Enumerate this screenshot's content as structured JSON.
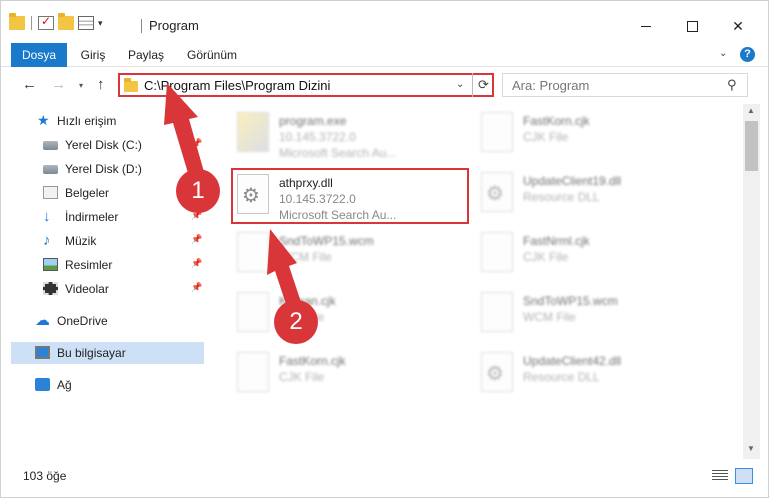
{
  "window": {
    "title": "Program",
    "qat_dropdown": "▾",
    "close_glyph": "✕"
  },
  "ribbon": {
    "tabs": [
      "Dosya",
      "Giriş",
      "Paylaş",
      "Görünüm"
    ],
    "expand_glyph": "⌄",
    "help_glyph": "?"
  },
  "nav": {
    "back": "←",
    "forward": "→",
    "recent": "▾",
    "up": "↑",
    "address": "C:\\Program Files\\Program Dizini",
    "address_dropdown": "⌄",
    "refresh": "⟳",
    "search_placeholder": "Ara: Program",
    "search_icon": "⚲"
  },
  "sidebar": {
    "items": [
      {
        "label": "Hızlı erişim",
        "icon": "star-icon"
      },
      {
        "label": "Yerel Disk (C:)",
        "icon": "disk-icon",
        "pinned": true
      },
      {
        "label": "Yerel Disk (D:)",
        "icon": "disk-icon",
        "pinned": true
      },
      {
        "label": "Belgeler",
        "icon": "document-icon",
        "pinned": true
      },
      {
        "label": "İndirmeler",
        "icon": "download-icon",
        "pinned": true
      },
      {
        "label": "Müzik",
        "icon": "music-icon",
        "pinned": true
      },
      {
        "label": "Resimler",
        "icon": "pictures-icon",
        "pinned": true
      },
      {
        "label": "Videolar",
        "icon": "videos-icon",
        "pinned": true
      },
      {
        "label": "OneDrive",
        "icon": "cloud-icon"
      },
      {
        "label": "Bu bilgisayar",
        "icon": "computer-icon",
        "selected": true
      },
      {
        "label": "Ağ",
        "icon": "network-icon"
      }
    ],
    "pin_glyph": "📌"
  },
  "files": [
    {
      "name": "program.exe",
      "line2": "10.145.3722.0",
      "line3": "Microsoft Search Au...",
      "icon": "exe-icon"
    },
    {
      "name": "FastKorn.cjk",
      "line2": "CJK File",
      "line3": "",
      "icon": "file-icon"
    },
    {
      "name": "athprxy.dll",
      "line2": "10.145.3722.0",
      "line3": "Microsoft Search Au...",
      "icon": "dll-gear-icon",
      "highlight": true
    },
    {
      "name": "UpdateClient19.dll",
      "line2": "Resource DLL",
      "line3": "",
      "icon": "dll-gear-icon"
    },
    {
      "name": "SndToWP15.wcm",
      "line2": "WCM File",
      "line3": "",
      "icon": "file-icon"
    },
    {
      "name": "FastNrml.cjk",
      "line2": "CJK File",
      "line3": "",
      "icon": "file-icon"
    },
    {
      "name": "Korean.cjk",
      "line2": "CJK File",
      "line3": "",
      "icon": "file-icon"
    },
    {
      "name": "SndToWP15.wcm",
      "line2": "WCM File",
      "line3": "",
      "icon": "file-icon"
    },
    {
      "name": "FastKorn.cjk",
      "line2": "CJK File",
      "line3": "",
      "icon": "file-icon"
    },
    {
      "name": "UpdateClient42.dll",
      "line2": "Resource DLL",
      "line3": "",
      "icon": "dll-gear-icon"
    }
  ],
  "status": {
    "item_count": "103 öğe"
  },
  "annotations": {
    "step1": "1",
    "step2": "2",
    "color": "#d9363a"
  }
}
